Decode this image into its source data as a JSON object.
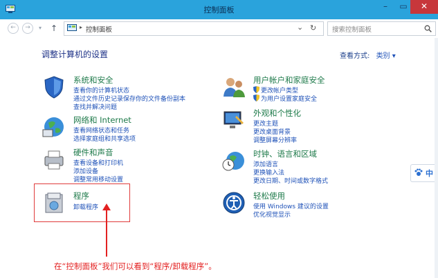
{
  "window": {
    "title": "控制面板"
  },
  "nav": {
    "back": "←",
    "forward": "→",
    "up": "↑"
  },
  "address": {
    "separator": "▸",
    "path": "控制面板",
    "dropdown": "⌄",
    "refresh": "↻"
  },
  "search": {
    "placeholder": "搜索控制面板",
    "icon": "🔍"
  },
  "main": {
    "heading": "调整计算机的设置",
    "viewby_label": "查看方式:",
    "viewby_value": "类别 ▾"
  },
  "categories": {
    "system": {
      "title": "系统和安全",
      "links": [
        "查看你的计算机状态",
        "通过文件历史记录保存你的文件备份副本",
        "查找并解决问题"
      ]
    },
    "network": {
      "title": "网络和 Internet",
      "links": [
        "查看网络状态和任务",
        "选择家庭组和共享选项"
      ]
    },
    "hardware": {
      "title": "硬件和声音",
      "links": [
        "查看设备和打印机",
        "添加设备",
        "调整常用移动设置"
      ]
    },
    "programs": {
      "title": "程序",
      "links": [
        "卸载程序"
      ]
    },
    "users": {
      "title": "用户帐户和家庭安全",
      "links": [
        "更改帐户类型",
        "为用户设置家庭安全"
      ]
    },
    "appearance": {
      "title": "外观和个性化",
      "links": [
        "更改主题",
        "更改桌面背景",
        "调整屏幕分辨率"
      ]
    },
    "clock": {
      "title": "时钟、语言和区域",
      "links": [
        "添加语言",
        "更换输入法",
        "更改日期、时间或数字格式"
      ]
    },
    "ease": {
      "title": "轻松使用",
      "links": [
        "使用 Windows 建议的设置",
        "优化视觉显示"
      ]
    }
  },
  "annotation": {
    "caption": "在“控制面板”我们可以看到“程序/卸载程序”。"
  },
  "badge": {
    "label": "中"
  },
  "colors": {
    "titlebar": "#2aa3dc",
    "category_title": "#1e7a4a",
    "link": "#1f52b8",
    "annotation": "#e32121",
    "close": "#c7373b"
  }
}
